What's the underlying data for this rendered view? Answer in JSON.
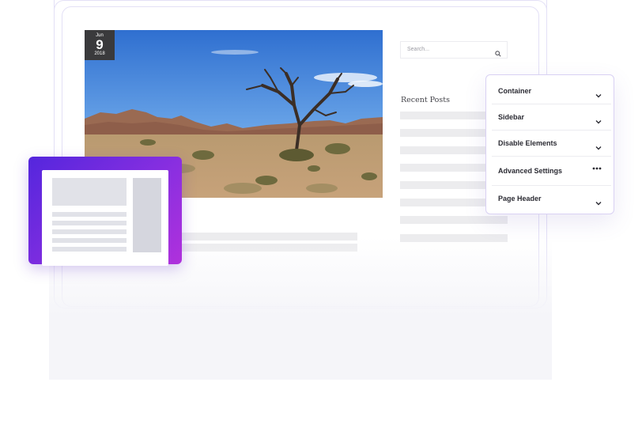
{
  "post": {
    "date": {
      "month": "Jun",
      "day": "9",
      "year": "2018"
    }
  },
  "sidebar": {
    "search_placeholder": "Search...",
    "recent_posts_title": "Recent Posts"
  },
  "settings_panel": {
    "items": [
      {
        "label": "Container",
        "icon": "chevron-down-icon"
      },
      {
        "label": "Sidebar",
        "icon": "chevron-down-icon"
      },
      {
        "label": "Disable Elements",
        "icon": "chevron-down-icon"
      },
      {
        "label": "Advanced Settings",
        "icon": "more-dots-icon"
      },
      {
        "label": "Page Header",
        "icon": "chevron-down-icon"
      }
    ]
  },
  "colors": {
    "accent_start": "#5426dd",
    "accent_end": "#b031dc",
    "panel_border": "#d9d1f3",
    "placeholder_bar": "#ececee"
  }
}
